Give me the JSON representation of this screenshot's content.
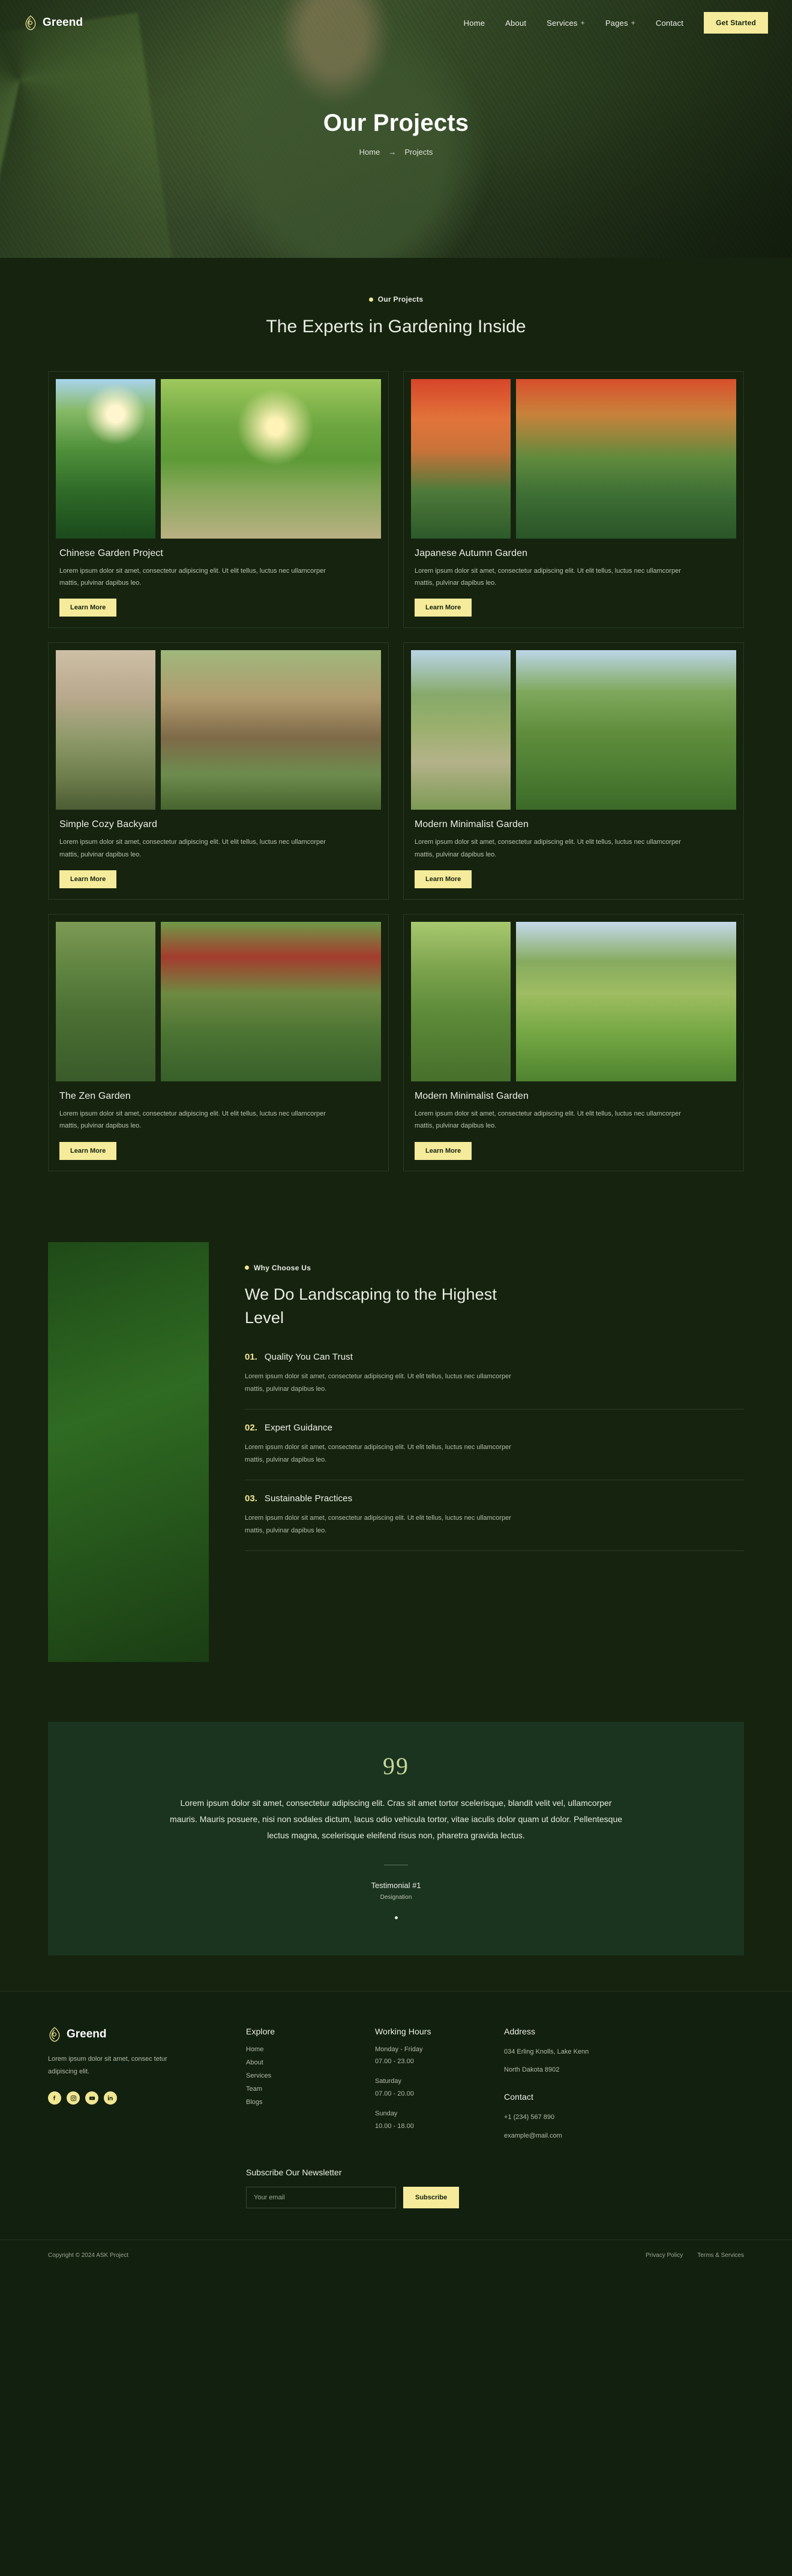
{
  "brand": {
    "name": "Greend",
    "logo_icon": "leaf-logo-icon"
  },
  "nav": {
    "items": [
      {
        "label": "Home",
        "has_submenu": false
      },
      {
        "label": "About",
        "has_submenu": false
      },
      {
        "label": "Services",
        "has_submenu": true
      },
      {
        "label": "Pages",
        "has_submenu": true
      },
      {
        "label": "Contact",
        "has_submenu": false
      }
    ],
    "cta_label": "Get Started"
  },
  "hero": {
    "title": "Our Projects",
    "breadcrumb": {
      "home": "Home",
      "separator": "→",
      "current": "Projects"
    }
  },
  "projects_section": {
    "eyebrow": "Our Projects",
    "title": "The Experts in Gardening Inside",
    "learn_more_label": "Learn More",
    "description": "Lorem ipsum dolor sit amet, consectetur adipiscing elit. Ut elit tellus, luctus nec ullamcorper mattis, pulvinar dapibus leo.",
    "cards": [
      {
        "title": "Chinese Garden Project"
      },
      {
        "title": "Japanese Autumn Garden"
      },
      {
        "title": "Simple Cozy Backyard"
      },
      {
        "title": "Modern Minimalist Garden"
      },
      {
        "title": "The Zen Garden"
      },
      {
        "title": "Modern Minimalist Garden"
      }
    ]
  },
  "why": {
    "eyebrow": "Why Choose Us",
    "title": "We Do Landscaping to the Highest Level",
    "items": [
      {
        "num": "01.",
        "label": "Quality You Can Trust",
        "body": "Lorem ipsum dolor sit amet, consectetur adipiscing elit. Ut elit tellus, luctus nec ullamcorper mattis, pulvinar dapibus leo."
      },
      {
        "num": "02.",
        "label": "Expert Guidance",
        "body": "Lorem ipsum dolor sit amet, consectetur adipiscing elit. Ut elit tellus, luctus nec ullamcorper mattis, pulvinar dapibus leo."
      },
      {
        "num": "03.",
        "label": "Sustainable Practices",
        "body": "Lorem ipsum dolor sit amet, consectetur adipiscing elit. Ut elit tellus, luctus nec ullamcorper mattis, pulvinar dapibus leo."
      }
    ]
  },
  "testimonial": {
    "quote_mark": "99",
    "text": "Lorem ipsum dolor sit amet, consectetur adipiscing elit. Cras sit amet tortor scelerisque, blandit velit vel, ullamcorper mauris. Mauris posuere, nisi non sodales dictum, lacus odio vehicula tortor, vitae iaculis dolor quam ut dolor. Pellentesque lectus magna, scelerisque eleifend risus non, pharetra gravida lectus.",
    "name": "Testimonial #1",
    "role": "Designation"
  },
  "footer": {
    "description": "Lorem ipsum dolor sit amet, consec tetur adipiscing elit.",
    "socials": [
      "facebook-icon",
      "instagram-icon",
      "youtube-icon",
      "linkedin-icon"
    ],
    "explore": {
      "heading": "Explore",
      "links": [
        "Home",
        "About",
        "Services",
        "Team",
        "Blogs"
      ]
    },
    "working_hours": {
      "heading": "Working Hours",
      "rows": [
        {
          "days": "Monday - Friday",
          "time": "07.00 - 23.00"
        },
        {
          "days": "Saturday",
          "time": "07.00 - 20.00"
        },
        {
          "days": "Sunday",
          "time": "10.00 - 18.00"
        }
      ]
    },
    "address": {
      "heading": "Address",
      "line1": "034 Erling Knolls, Lake Kenn",
      "line2": "North Dakota 8902"
    },
    "contact": {
      "heading": "Contact",
      "phone": "+1 (234) 567 890",
      "email": "example@mail.com"
    },
    "newsletter": {
      "heading": "Subscribe Our Newsletter",
      "placeholder": "Your email",
      "button_label": "Subscribe"
    },
    "copyright": "Copyright © 2024 ASK Project",
    "legal": [
      "Privacy Policy",
      "Terms & Services"
    ]
  },
  "colors": {
    "accent": "#f5eb9a",
    "bg_dark": "#16240f",
    "bg_darker": "#12200f",
    "testimonial_bg": "#1b3420"
  }
}
